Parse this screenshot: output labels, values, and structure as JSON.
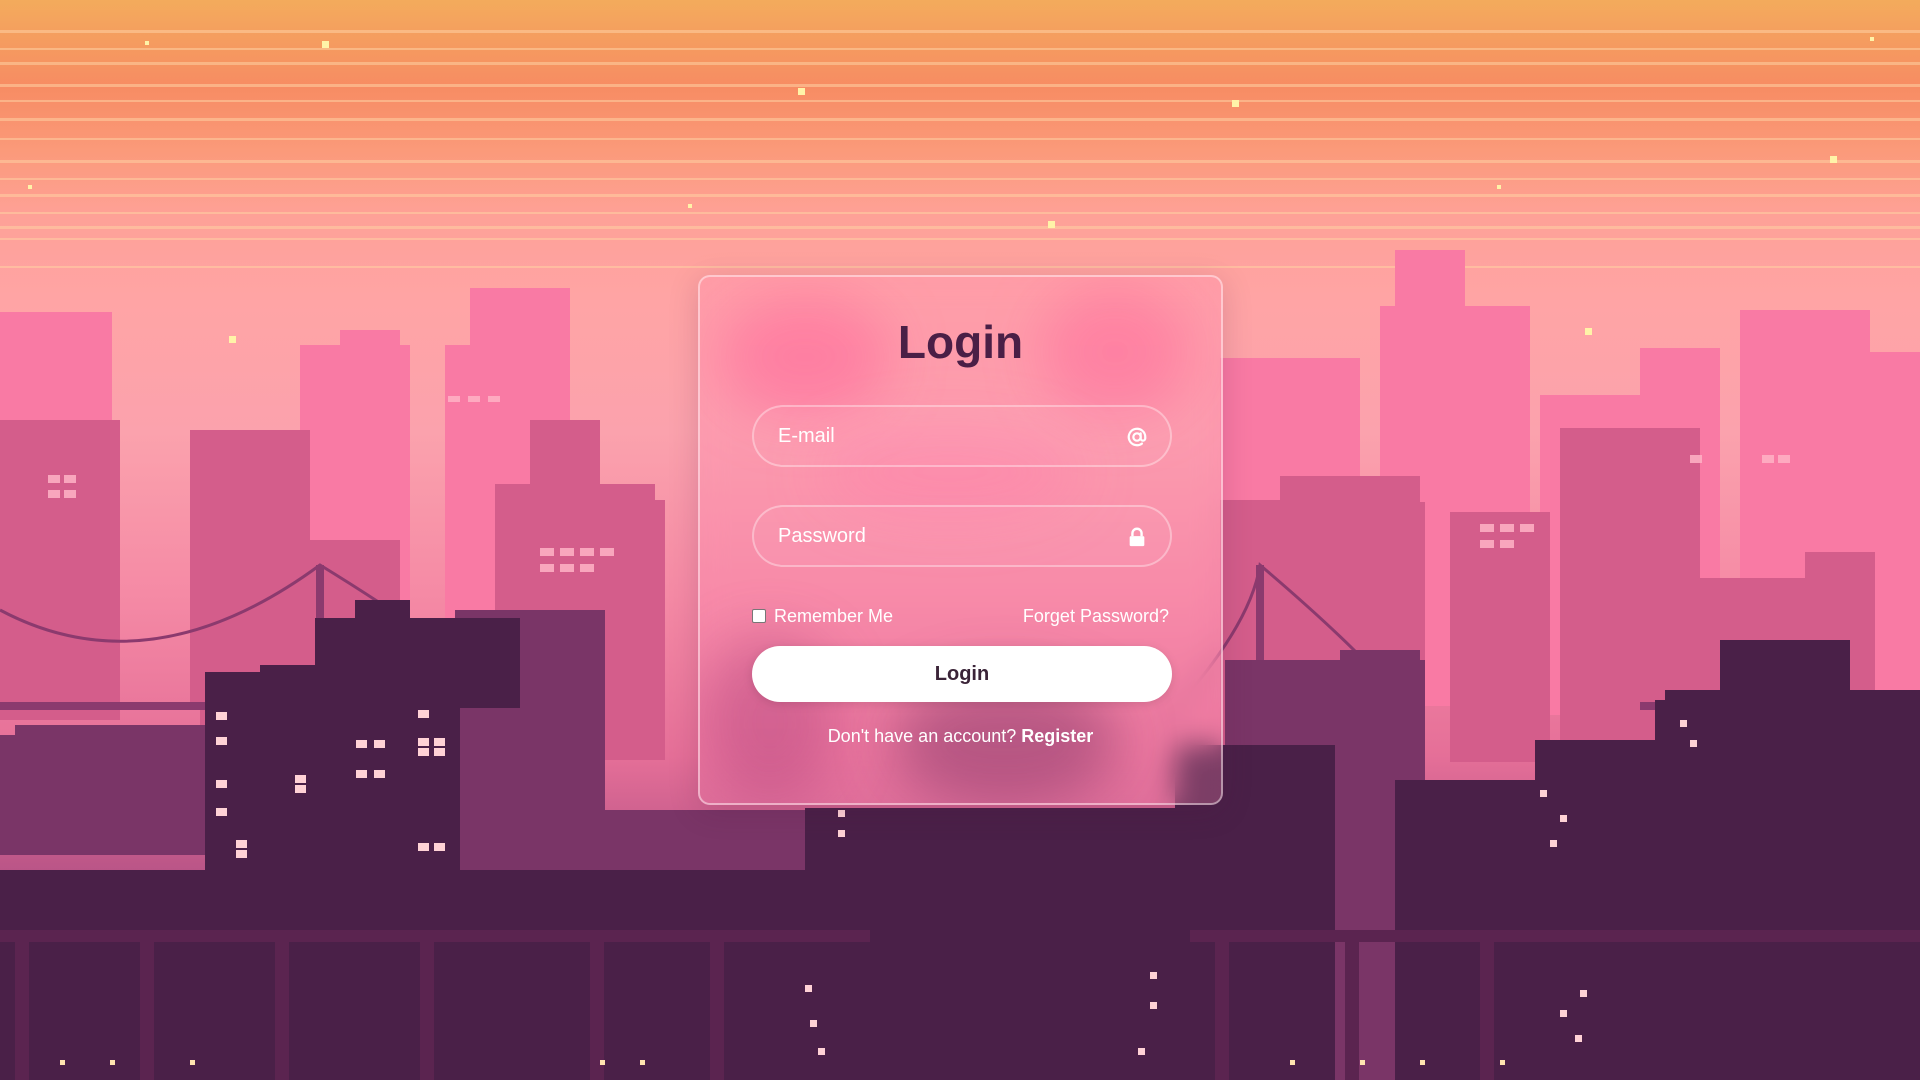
{
  "colors": {
    "title": "#4a1f46",
    "button_bg": "#ffffff",
    "button_text": "#3b2438",
    "text": "#ffffff"
  },
  "login_form": {
    "title": "Login",
    "email": {
      "placeholder": "E-mail",
      "value": "",
      "icon": "at-sign-icon"
    },
    "password": {
      "placeholder": "Password",
      "value": "",
      "icon": "lock-icon"
    },
    "remember_me": {
      "label": "Remember Me",
      "checked": false
    },
    "forgot_password": "Forget Password?",
    "submit_label": "Login",
    "register_prompt": "Don't have an account?",
    "register_link": "Register"
  }
}
